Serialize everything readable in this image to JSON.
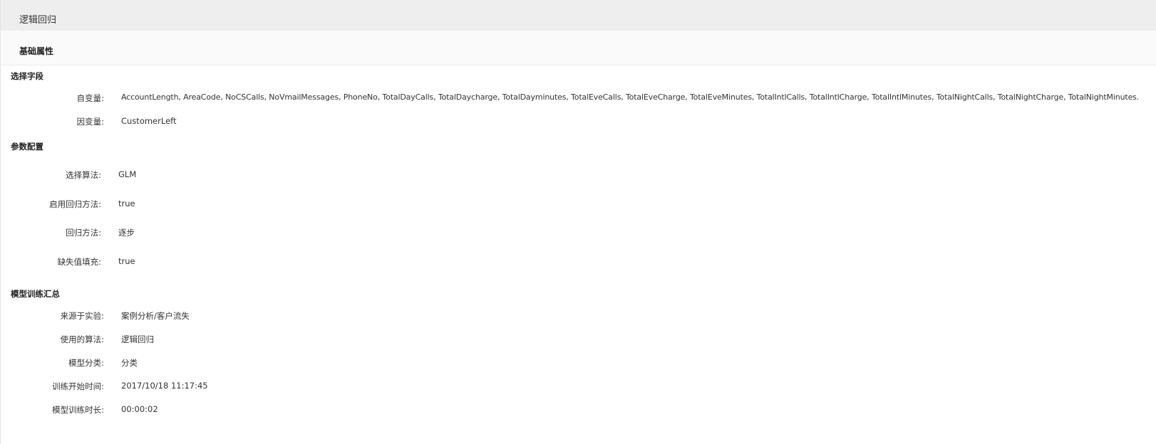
{
  "window": {
    "title": "逻辑回归"
  },
  "tabs": {
    "active_label": "基础属性"
  },
  "sections": {
    "field_selection": {
      "title": "选择字段",
      "independent_label": "自变量:",
      "independent_value": "AccountLength, AreaCode, NoCSCalls, NoVmailMessages, PhoneNo, TotalDayCalls, TotalDaycharge, TotalDayminutes, TotalEveCalls, TotalEveCharge, TotalEveMinutes, TotalIntlCalls, TotalIntlCharge, TotalIntlMinutes, TotalNightCalls, TotalNightCharge, TotalNightMinutes.",
      "dependent_label": "因变量:",
      "dependent_value": "CustomerLeft"
    },
    "param_config": {
      "title": "参数配置",
      "algorithm_label": "选择算法:",
      "algorithm_value": "GLM",
      "enable_regression_label": "启用回归方法:",
      "enable_regression_value": "true",
      "regression_method_label": "回归方法:",
      "regression_method_value": "逐步",
      "missing_fill_label": "缺失值填充:",
      "missing_fill_value": "true"
    },
    "training_summary": {
      "title": "模型训练汇总",
      "source_label": "来源于实验:",
      "source_value": "案例分析/客户流失",
      "used_algorithm_label": "使用的算法:",
      "used_algorithm_value": "逻辑回归",
      "model_class_label": "模型分类:",
      "model_class_value": "分类",
      "start_time_label": "训练开始时间:",
      "start_time_value": "2017/10/18 11:17:45",
      "duration_label": "模型训练时长:",
      "duration_value": "00:00:02"
    }
  }
}
